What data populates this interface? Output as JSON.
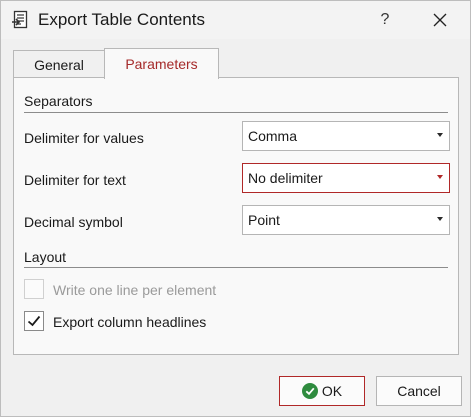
{
  "window": {
    "title": "Export Table Contents",
    "help_glyph": "?",
    "icon": "export-table-icon"
  },
  "tabs": [
    {
      "label": "General",
      "active": false
    },
    {
      "label": "Parameters",
      "active": true
    }
  ],
  "separators": {
    "title": "Separators",
    "rows": [
      {
        "label": "Delimiter for values",
        "value": "Comma",
        "focused": false
      },
      {
        "label": "Delimiter for text",
        "value": "No delimiter",
        "focused": true
      },
      {
        "label": "Decimal symbol",
        "value": "Point",
        "focused": false
      }
    ]
  },
  "layout": {
    "title": "Layout",
    "options": [
      {
        "label": "Write one line per element",
        "checked": false,
        "enabled": false
      },
      {
        "label": "Export column headlines",
        "checked": true,
        "enabled": true
      }
    ]
  },
  "buttons": {
    "ok_label": "OK",
    "cancel_label": "Cancel"
  },
  "colors": {
    "accent": "#b02828",
    "ok_icon": "#2e8b3e"
  }
}
